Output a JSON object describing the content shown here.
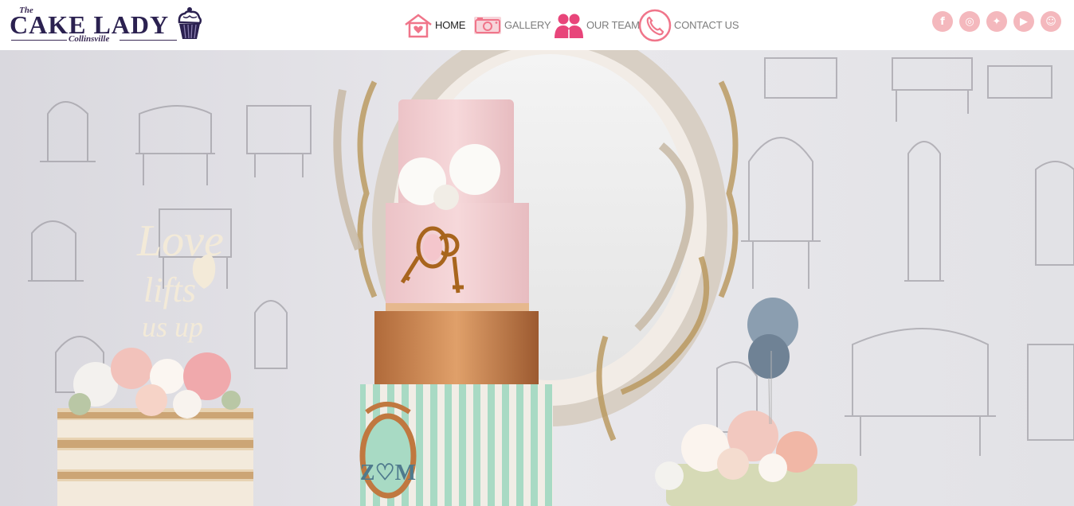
{
  "brand": {
    "the": "The",
    "name": "CAKE LADY",
    "location": "Collinsville"
  },
  "nav": {
    "items": [
      {
        "label": "HOME",
        "icon": "house-heart-icon",
        "active": true
      },
      {
        "label": "GALLERY",
        "icon": "camera-icon",
        "active": false
      },
      {
        "label": "OUR TEAM",
        "icon": "people-icon",
        "active": false
      },
      {
        "label": "CONTACT US",
        "icon": "phone-icon",
        "active": false
      }
    ]
  },
  "social": {
    "items": [
      {
        "icon": "facebook-icon",
        "glyph": "f"
      },
      {
        "icon": "instagram-icon",
        "glyph": "◎"
      },
      {
        "icon": "twitter-icon",
        "glyph": "✦"
      },
      {
        "icon": "youtube-icon",
        "glyph": "▶"
      },
      {
        "icon": "snapchat-icon",
        "glyph": "☺"
      }
    ]
  },
  "hero": {
    "topper_text": [
      "Love",
      "lifts",
      "us up"
    ],
    "monogram": "Z♡M"
  },
  "colors": {
    "accent_pink": "#f0758a",
    "brand_purple": "#2b2150",
    "social_pink": "#f4b8bd"
  }
}
